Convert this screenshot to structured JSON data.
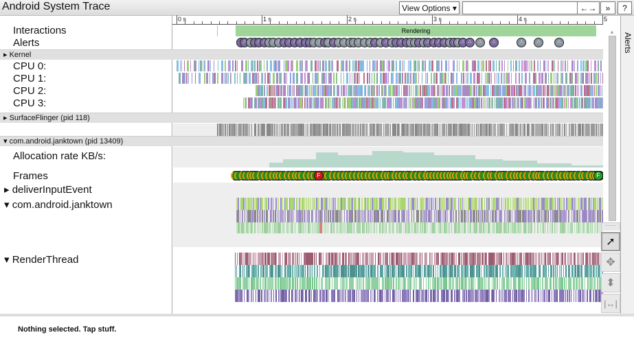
{
  "title": "Android System Trace",
  "toolbar": {
    "view_options": "View Options ▾",
    "search_value": "",
    "zoom_icon": "←→",
    "next": "»",
    "help": "?"
  },
  "ruler": {
    "ticks": [
      "0 s",
      "1 s",
      "2 s",
      "3 s",
      "4 s",
      "5 s"
    ]
  },
  "tracks": {
    "interactions": "Interactions",
    "rendering": "Rendering",
    "alerts": "Alerts",
    "kernel": "Kernel",
    "cpus": [
      "CPU 0:",
      "CPU 1:",
      "CPU 2:",
      "CPU 3:"
    ],
    "surfaceflinger": "SurfaceFlinger (pid 118)",
    "janktown_process": "com.android.janktown (pid 13409)",
    "allocation": "Allocation rate KB/s:",
    "frames": "Frames",
    "frame_marker": "F",
    "deliver": "deliverInputEvent",
    "janktown_thread": "com.android.janktown",
    "renderthread": "RenderThread"
  },
  "side_panel": {
    "label": "Alerts"
  },
  "status": "Nothing selected. Tap stuff.",
  "tools": [
    "select-icon",
    "pan-icon",
    "zoom-icon",
    "timing-icon"
  ],
  "colors": {
    "rendering": "#9fd49a",
    "alert": "#7a6aa0",
    "frame_good": "#2a9a2a",
    "frame_bad": "#c81d1d",
    "alloc": "#b8d8cc"
  }
}
